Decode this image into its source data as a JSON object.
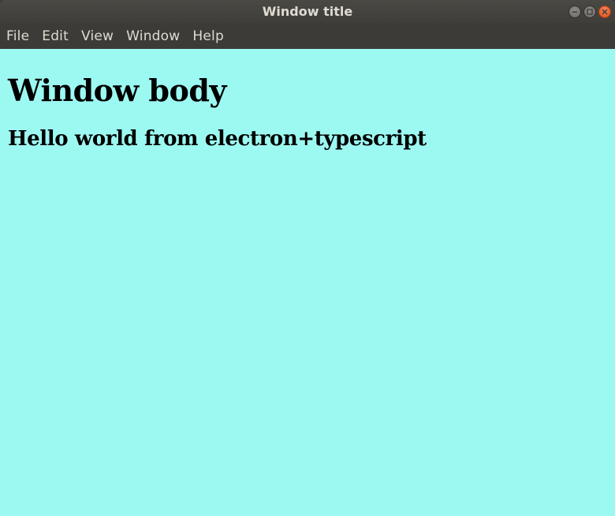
{
  "window": {
    "title": "Window title"
  },
  "menubar": {
    "items": [
      {
        "label": "File"
      },
      {
        "label": "Edit"
      },
      {
        "label": "View"
      },
      {
        "label": "Window"
      },
      {
        "label": "Help"
      }
    ]
  },
  "content": {
    "heading": "Window body",
    "subheading": "Hello world from electron+typescript"
  },
  "colors": {
    "titlebar": "#3c3b37",
    "body_background": "#9cf9f2",
    "close_button": "#df4b16",
    "menu_text": "#dfdbd2"
  },
  "icons": {
    "minimize": "minimize-icon",
    "maximize": "maximize-icon",
    "close": "close-icon"
  }
}
